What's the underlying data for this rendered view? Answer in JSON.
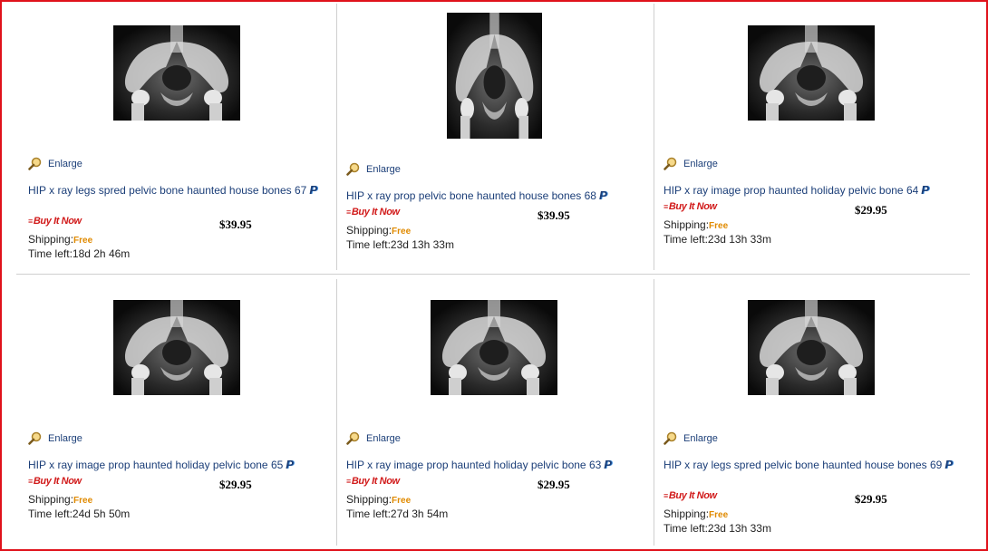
{
  "listings": [
    {
      "title": "HIP x ray legs spred pelvic bone haunted house bones 67",
      "price": "$39.95",
      "time_left": "18d 2h 46m",
      "enlarge_label": "Enlarge",
      "buy_label": "Buy It Now",
      "shipping_label": "Shipping:",
      "shipping_value": "Free",
      "time_label": "Time left:",
      "paypal_icon": "paypal-icon"
    },
    {
      "title": "HIP x ray prop pelvic bone haunted house bones 68",
      "price": "$39.95",
      "time_left": "23d 13h 33m",
      "enlarge_label": "Enlarge",
      "buy_label": "Buy It Now",
      "shipping_label": "Shipping:",
      "shipping_value": "Free",
      "time_label": "Time left:",
      "paypal_icon": "paypal-icon"
    },
    {
      "title": "HIP x ray image prop haunted holiday pelvic bone 64",
      "price": "$29.95",
      "time_left": "23d 13h 33m",
      "enlarge_label": "Enlarge",
      "buy_label": "Buy It Now",
      "shipping_label": "Shipping:",
      "shipping_value": "Free",
      "time_label": "Time left:",
      "paypal_icon": "paypal-icon"
    },
    {
      "title": "HIP x ray image prop haunted holiday pelvic bone 65",
      "price": "$29.95",
      "time_left": "24d 5h 50m",
      "enlarge_label": "Enlarge",
      "buy_label": "Buy It Now",
      "shipping_label": "Shipping:",
      "shipping_value": "Free",
      "time_label": "Time left:",
      "paypal_icon": "paypal-icon"
    },
    {
      "title": "HIP x ray image prop haunted holiday pelvic bone 63",
      "price": "$29.95",
      "time_left": "27d 3h 54m",
      "enlarge_label": "Enlarge",
      "buy_label": "Buy It Now",
      "shipping_label": "Shipping:",
      "shipping_value": "Free",
      "time_label": "Time left:",
      "paypal_icon": "paypal-icon"
    },
    {
      "title": "HIP x ray legs spred pelvic bone haunted house bones 69",
      "price": "$29.95",
      "time_left": "23d 13h 33m",
      "enlarge_label": "Enlarge",
      "buy_label": "Buy It Now",
      "shipping_label": "Shipping:",
      "shipping_value": "Free",
      "time_label": "Time left:",
      "paypal_icon": "paypal-icon"
    }
  ],
  "colors": {
    "frame": "#e0121b",
    "link": "#1b3e78",
    "buy_it_now": "#d11a1a",
    "free": "#e08a00"
  }
}
